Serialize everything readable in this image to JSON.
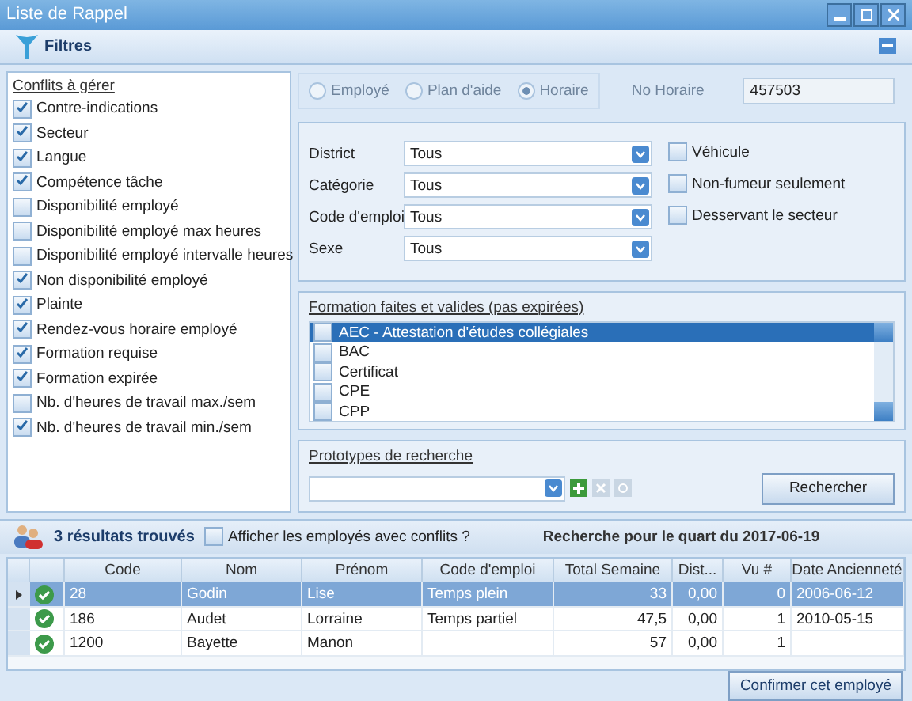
{
  "window": {
    "title": "Liste de Rappel"
  },
  "filters_bar": {
    "title": "Filtres"
  },
  "conflicts": {
    "title": "Conflits à gérer",
    "items": [
      {
        "label": "Contre-indications",
        "checked": true
      },
      {
        "label": "Secteur",
        "checked": true
      },
      {
        "label": "Langue",
        "checked": true
      },
      {
        "label": "Compétence tâche",
        "checked": true
      },
      {
        "label": "Disponibilité employé",
        "checked": false
      },
      {
        "label": "Disponibilité employé max heures",
        "checked": false
      },
      {
        "label": "Disponibilité employé intervalle heures",
        "checked": false
      },
      {
        "label": "Non disponibilité employé",
        "checked": true
      },
      {
        "label": "Plainte",
        "checked": true
      },
      {
        "label": "Rendez-vous horaire employé",
        "checked": true
      },
      {
        "label": "Formation requise",
        "checked": true
      },
      {
        "label": "Formation expirée",
        "checked": true
      },
      {
        "label": "Nb. d'heures de travail max./sem",
        "checked": false
      },
      {
        "label": "Nb. d'heures de travail min./sem",
        "checked": true
      }
    ]
  },
  "mode": {
    "disabled": true,
    "options": [
      {
        "label": "Employé",
        "selected": false
      },
      {
        "label": "Plan d'aide",
        "selected": false
      },
      {
        "label": "Horaire",
        "selected": true
      }
    ],
    "number_label": "No Horaire",
    "number_value": "457503"
  },
  "criteria": {
    "dropdowns": [
      {
        "label": "District",
        "value": "Tous"
      },
      {
        "label": "Catégorie",
        "value": "Tous"
      },
      {
        "label": "Code d'emploi",
        "value": "Tous"
      },
      {
        "label": "Sexe",
        "value": "Tous"
      }
    ],
    "options": [
      {
        "label": "Véhicule",
        "checked": false
      },
      {
        "label": "Non-fumeur seulement",
        "checked": false
      },
      {
        "label": "Desservant le secteur",
        "checked": false
      }
    ]
  },
  "training": {
    "title": "Formation faites et valides (pas expirées)",
    "items": [
      {
        "label": "AEC - Attestation d'études collégiales",
        "checked": false,
        "selected": true
      },
      {
        "label": "BAC",
        "checked": false,
        "selected": false
      },
      {
        "label": "Certificat",
        "checked": false,
        "selected": false
      },
      {
        "label": "CPE",
        "checked": false,
        "selected": false
      },
      {
        "label": "CPP",
        "checked": false,
        "selected": false
      }
    ]
  },
  "prototypes": {
    "title": "Prototypes de recherche",
    "search_button": "Rechercher"
  },
  "results": {
    "count": "3 résultats trouvés",
    "show_conflicts": {
      "label": "Afficher les employés avec conflits ?",
      "checked": false
    },
    "shift": "Recherche pour le quart du 2017-06-19"
  },
  "table": {
    "columns": [
      "Code",
      "Nom",
      "Prénom",
      "Code d'emploi",
      "Total Semaine",
      "Dist...",
      "Vu #",
      "Date Ancienneté"
    ],
    "rows": [
      {
        "selected": true,
        "no_conflict": true,
        "cells": [
          "28",
          "Godin",
          "Lise",
          "Temps plein",
          "33",
          "0,00",
          "0",
          "2006-06-12"
        ]
      },
      {
        "selected": false,
        "no_conflict": true,
        "cells": [
          "186",
          "Audet",
          "Lorraine",
          "Temps partiel",
          "47,5",
          "0,00",
          "1",
          "2010-05-15"
        ]
      },
      {
        "selected": false,
        "no_conflict": true,
        "cells": [
          "1200",
          "Bayette",
          "Manon",
          "",
          "57",
          "0,00",
          "1",
          ""
        ]
      }
    ]
  },
  "confirm_button": "Confirmer cet employé"
}
